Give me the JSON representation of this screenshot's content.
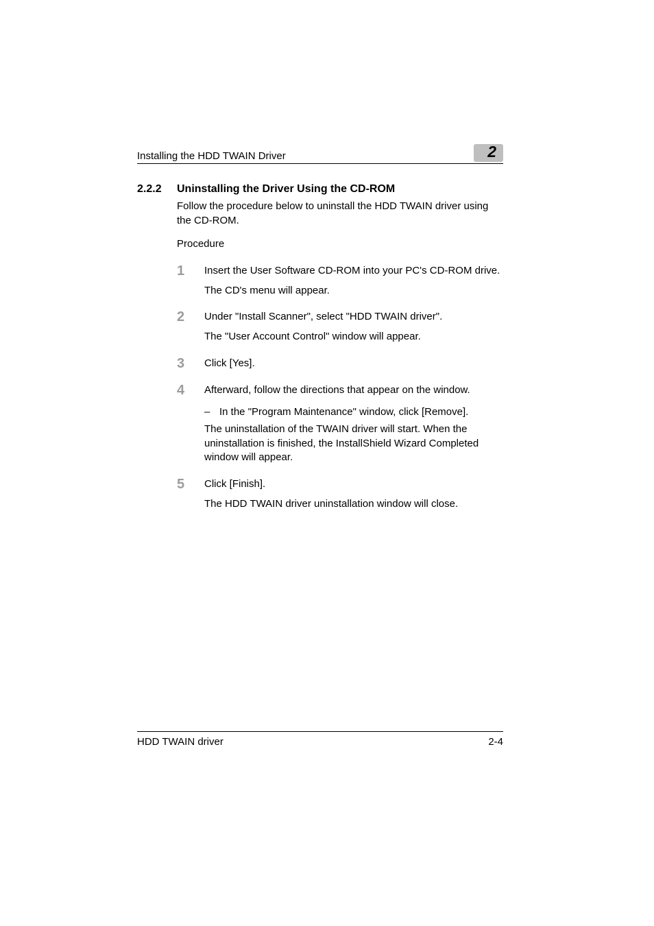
{
  "header": {
    "running_title": "Installing the HDD TWAIN Driver",
    "chapter_number": "2"
  },
  "section": {
    "number": "2.2.2",
    "title": "Uninstalling the Driver Using the CD-ROM",
    "intro": "Follow the procedure below to uninstall the HDD TWAIN driver using the CD-ROM.",
    "procedure_label": "Procedure"
  },
  "steps": [
    {
      "num": "1",
      "lines": [
        "Insert the User Software CD-ROM into your PC's CD-ROM drive.",
        "The CD's menu will appear."
      ]
    },
    {
      "num": "2",
      "lines": [
        "Under \"Install Scanner\", select \"HDD TWAIN driver\".",
        "The \"User Account Control\" window will appear."
      ]
    },
    {
      "num": "3",
      "lines": [
        "Click [Yes]."
      ]
    },
    {
      "num": "4",
      "lines": [
        "Afterward, follow the directions that appear on the window."
      ],
      "bullet": "In the \"Program Maintenance\" window, click [Remove].",
      "after": "The uninstallation of the TWAIN driver will start. When the uninstallation is finished, the InstallShield Wizard Completed window will appear."
    },
    {
      "num": "5",
      "lines": [
        "Click [Finish].",
        "The HDD TWAIN driver uninstallation window will close."
      ]
    }
  ],
  "footer": {
    "product": "HDD TWAIN driver",
    "page_number": "2-4"
  }
}
